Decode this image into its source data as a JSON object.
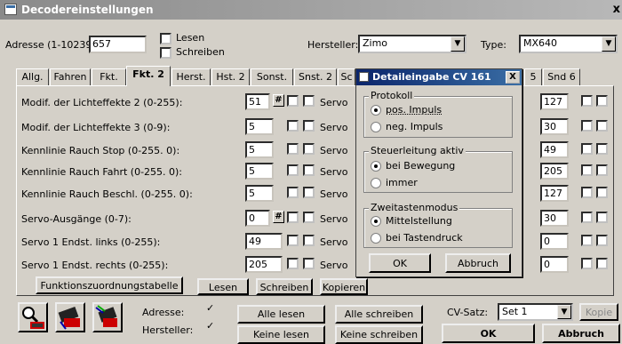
{
  "window": {
    "title": "Decodereinstellungen",
    "close": "x"
  },
  "header": {
    "adresse_label": "Adresse (1-10239):",
    "adresse_value": "657",
    "lesen_label": "Lesen",
    "schreiben_label": "Schreiben",
    "hersteller_label": "Hersteller:",
    "hersteller_value": "Zimo",
    "type_label": "Type:",
    "type_value": "MX640"
  },
  "tabs": [
    {
      "label": "Allg."
    },
    {
      "label": "Fahren"
    },
    {
      "label": "Fkt."
    },
    {
      "label": "Fkt. 2"
    },
    {
      "label": "Herst."
    },
    {
      "label": "Hst. 2"
    },
    {
      "label": "Sonst."
    },
    {
      "label": "Snst. 2"
    },
    {
      "label": "Sc"
    },
    {
      "label": "5"
    },
    {
      "label": "Snd 6"
    }
  ],
  "rows": [
    {
      "label": "Modif. der Lichteffekte 2 (0-255):",
      "value": "51",
      "servo": "Servo",
      "right_value": "127"
    },
    {
      "label": "Modif. der Lichteffekte 3 (0-9):",
      "value": "5",
      "servo": "Servo",
      "right_value": "30"
    },
    {
      "label": "Kennlinie Rauch Stop (0-255. 0):",
      "value": "5",
      "servo": "Servo",
      "right_value": "49"
    },
    {
      "label": "Kennlinie Rauch Fahrt (0-255. 0):",
      "value": "5",
      "servo": "Servo",
      "right_value": "205"
    },
    {
      "label": "Kennlinie Rauch Beschl. (0-255. 0):",
      "value": "5",
      "servo": "Servo",
      "right_value": "127"
    },
    {
      "label": "Servo-Ausgänge (0-7):",
      "value": "0",
      "servo": "Servo",
      "right_value": "30"
    },
    {
      "label": "Servo 1 Endst. links (0-255):",
      "value": "49",
      "servo": "Servo",
      "right_value": "0"
    },
    {
      "label": "Servo 1 Endst. rechts (0-255):",
      "value": "205",
      "servo": "Servo",
      "right_value": "0"
    }
  ],
  "hash_label": "#",
  "panel_buttons": {
    "funktion": "Funktionszuordnungstabelle",
    "lesen": "Lesen",
    "schreiben": "Schreiben",
    "kopieren": "Kopieren"
  },
  "dialog": {
    "title": "Detaileingabe CV 161",
    "close": "X",
    "protokoll": {
      "title": "Protokoll",
      "opt1": "pos. Impuls",
      "opt2": "neg. Impuls"
    },
    "steuer": {
      "title": "Steuerleitung aktiv",
      "opt1": "bei Bewegung",
      "opt2": "immer"
    },
    "zweit": {
      "title": "Zweitastenmodus",
      "opt1": "Mittelstellung",
      "opt2": "bei Tastendruck"
    },
    "ok": "OK",
    "abbruch": "Abbruch"
  },
  "footer": {
    "adresse_label": "Adresse:",
    "hersteller_label": "Hersteller:",
    "alle_lesen": "Alle lesen",
    "alle_schreiben": "Alle schreiben",
    "keine_lesen": "Keine lesen",
    "keine_schreiben": "Keine schreiben",
    "cvsatz_label": "CV-Satz:",
    "cvsatz_value": "Set 1",
    "kopie": "Kopie",
    "ok": "OK",
    "abbruch": "Abbruch"
  }
}
